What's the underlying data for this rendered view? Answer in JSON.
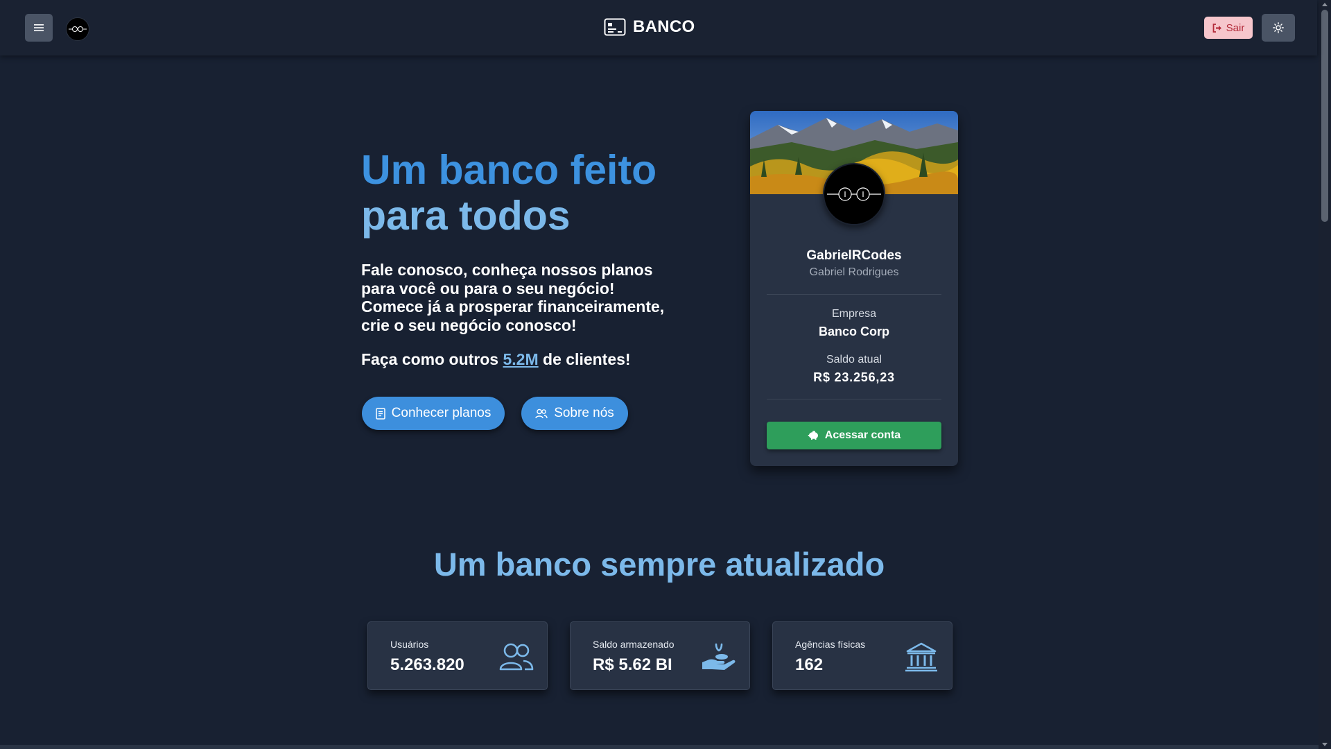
{
  "colors": {
    "background": "#182132",
    "accent": "#3d8fdd",
    "accent_light": "#7cb9ea",
    "success": "#2e9e5b",
    "danger_bg": "#f6c6cc",
    "card": "#283244"
  },
  "navbar": {
    "menu_icon": "hamburger-menu-icon",
    "brand_icon": "id-card-icon",
    "brand": "BANCO",
    "logout_label": "Sair",
    "logout_icon": "sign-out-icon",
    "theme_icon": "sun-icon"
  },
  "hero": {
    "title_line1": "Um banco feito",
    "title_line2": "para todos",
    "text": "Fale conosco, conheça nossos planos para você ou para o seu negócio! Comece já a prosperar financeiramente, crie o seu negócio conosco!",
    "clients_prefix": "Faça como outros",
    "clients_highlight": "5.2M",
    "clients_suffix": "de clientes!",
    "btn_plans": "Conhecer planos",
    "btn_about": "Sobre nós"
  },
  "profile": {
    "username": "GabrielRCodes",
    "fullname": "Gabriel Rodrigues",
    "company_label": "Empresa",
    "company": "Banco Corp",
    "balance_label": "Saldo atual",
    "balance": "R$ 23.256,23",
    "access_label": "Acessar conta",
    "access_icon": "piggy-bank-icon"
  },
  "stats": {
    "title": "Um banco sempre atualizado",
    "items": [
      {
        "label": "Usuários",
        "value": "5.263.820",
        "icon": "users-icon"
      },
      {
        "label": "Saldo armazenado",
        "value": "R$ 5.62 BI",
        "icon": "hand-coin-icon"
      },
      {
        "label": "Agências físicas",
        "value": "162",
        "icon": "bank-building-icon"
      }
    ]
  }
}
